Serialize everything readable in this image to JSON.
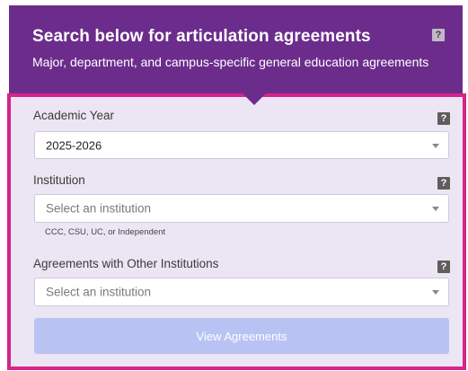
{
  "header": {
    "title": "Search below for articulation agreements",
    "subtitle": "Major, department, and campus-specific general education agreements",
    "help_glyph": "?"
  },
  "form": {
    "academic_year": {
      "label": "Academic Year",
      "value": "2025-2026",
      "help_glyph": "?"
    },
    "institution": {
      "label": "Institution",
      "placeholder": "Select an institution",
      "hint": "CCC, CSU, UC, or Independent",
      "help_glyph": "?"
    },
    "other_institutions": {
      "label": "Agreements with Other Institutions",
      "placeholder": "Select an institution",
      "help_glyph": "?"
    },
    "submit_label": "View Agreements"
  },
  "colors": {
    "header_bg": "#6c2c8c",
    "panel_border": "#d6248a",
    "panel_bg": "#ece6f4",
    "button_bg": "#b9c3f3"
  }
}
